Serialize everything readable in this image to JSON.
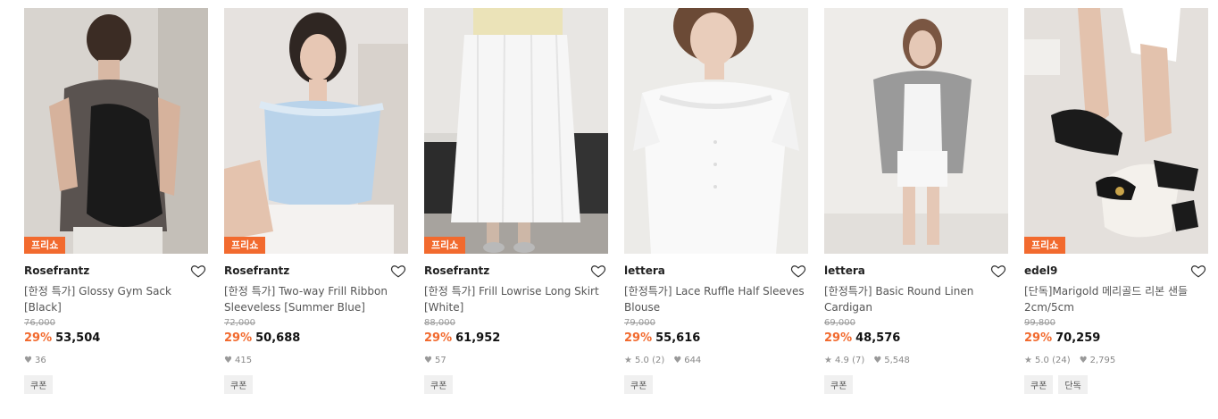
{
  "accent": "#f26a2e",
  "products": [
    {
      "badge": "프리쇼",
      "brand": "Rosefrantz",
      "title": "[한정 특가] Glossy Gym Sack [Black]",
      "original_price": "76,000",
      "discount": "29%",
      "price": "53,504",
      "likes": "36",
      "tags": [
        "쿠폰"
      ]
    },
    {
      "badge": "프리쇼",
      "brand": "Rosefrantz",
      "title": "[한정 특가] Two-way Frill Ribbon Sleeveless [Summer Blue]",
      "original_price": "72,000",
      "discount": "29%",
      "price": "50,688",
      "likes": "415",
      "tags": [
        "쿠폰"
      ]
    },
    {
      "badge": "프리쇼",
      "brand": "Rosefrantz",
      "title": "[한정 특가] Frill Lowrise Long Skirt [White]",
      "original_price": "88,000",
      "discount": "29%",
      "price": "61,952",
      "likes": "57",
      "tags": [
        "쿠폰"
      ]
    },
    {
      "brand": "lettera",
      "title": "[한정특가] Lace Ruffle Half Sleeves Blouse",
      "original_price": "79,000",
      "discount": "29%",
      "price": "55,616",
      "rating": "5.0",
      "reviews": "(2)",
      "likes": "644",
      "tags": [
        "쿠폰"
      ]
    },
    {
      "brand": "lettera",
      "title": "[한정특가] Basic Round Linen Cardigan",
      "original_price": "69,000",
      "discount": "29%",
      "price": "48,576",
      "rating": "4.9",
      "reviews": "(7)",
      "likes": "5,548",
      "tags": [
        "쿠폰"
      ]
    },
    {
      "badge": "프리쇼",
      "brand": "edel9",
      "title": "[단독]Marigold 메리골드 리본 샌들 2cm/5cm",
      "original_price": "99,800",
      "discount": "29%",
      "price": "70,259",
      "rating": "5.0",
      "reviews": "(24)",
      "likes": "2,795",
      "tags": [
        "쿠폰",
        "단독"
      ]
    }
  ]
}
